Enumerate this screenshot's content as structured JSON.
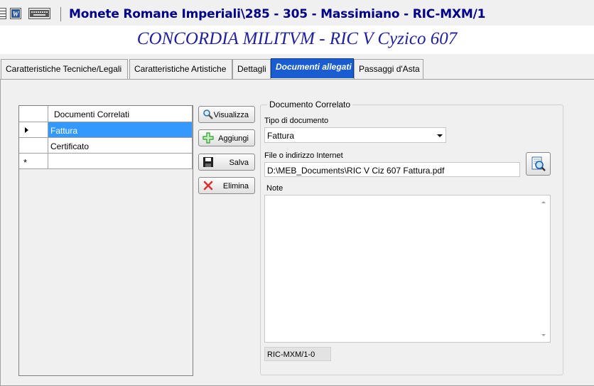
{
  "window": {
    "title": "Monete Romane Imperiali\\285 - 305 - Massimiano - RIC-MXM/1"
  },
  "toolbar": {
    "icons": [
      "grid-icon",
      "word-icon",
      "keyboard-icon"
    ]
  },
  "coin": {
    "legend": "CONCORDIA MILITVM - RIC V Cyzico 607"
  },
  "tabs": [
    {
      "label": "Caratteristiche Tecniche/Legali"
    },
    {
      "label": "Caratteristiche Artistiche"
    },
    {
      "label": "Dettagli"
    },
    {
      "label": "Documenti allegati",
      "active": true
    },
    {
      "label": "Passaggi d'Asta"
    }
  ],
  "grid": {
    "header": "Documenti Correlati",
    "rows": [
      "Fattura",
      "Certificato",
      ""
    ],
    "selected_index": 0,
    "new_row_marker": "*"
  },
  "buttons": {
    "view": "Visualizza",
    "add": "Aggiungi",
    "save": "Salva",
    "delete": "Elimina"
  },
  "detail": {
    "group_title": "Documento Correlato",
    "type_label": "Tipo di documento",
    "type_value": "Fattura",
    "file_label": "File o indirizzo Internet",
    "file_value": "D:\\MEB_Documents\\RIC V Ciz 607 Fattura.pdf",
    "note_label": "Note",
    "note_value": "",
    "code": "RIC-MXM/1-0"
  },
  "colors": {
    "title": "#00008b",
    "legend": "#2020a0",
    "active_tab": "#1a5dd0",
    "selection": "#3399ff"
  }
}
